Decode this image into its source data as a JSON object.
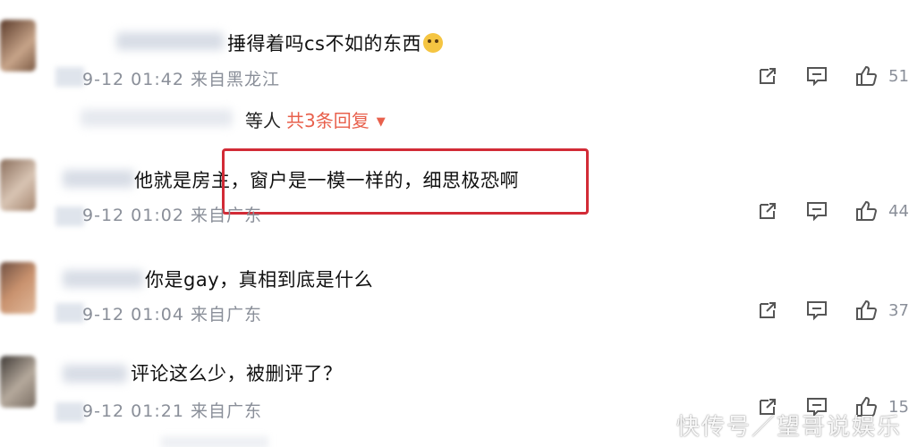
{
  "comments": [
    {
      "text": "捶得着吗cs不如的东西",
      "emoji": "smile-emoji",
      "meta": "9-12 01:42 来自黑龙江",
      "likes": "51"
    },
    {
      "text": "他就是房主，窗户是一模一样的，细思极恐啊",
      "meta": "9-12 01:02 来自广东",
      "likes": "44"
    },
    {
      "text": "你是gay，真相到底是什么",
      "meta": "9-12 01:04 来自广东",
      "likes": "37"
    },
    {
      "text": "评论这么少，被删评了？",
      "meta": "9-12 01:21 来自广东",
      "likes": "15"
    }
  ],
  "replies": {
    "prefix": "等人",
    "total": "共3条回复",
    "caret": "▼"
  },
  "watermark": "快传号／望哥说娱乐",
  "colors": {
    "highlight_box": "#d22b36",
    "reply_link": "#e8604c",
    "meta_gray": "#8a8f99"
  },
  "icons": {
    "share": "share-icon",
    "comment": "comment-icon",
    "like": "thumbs-up-icon"
  }
}
